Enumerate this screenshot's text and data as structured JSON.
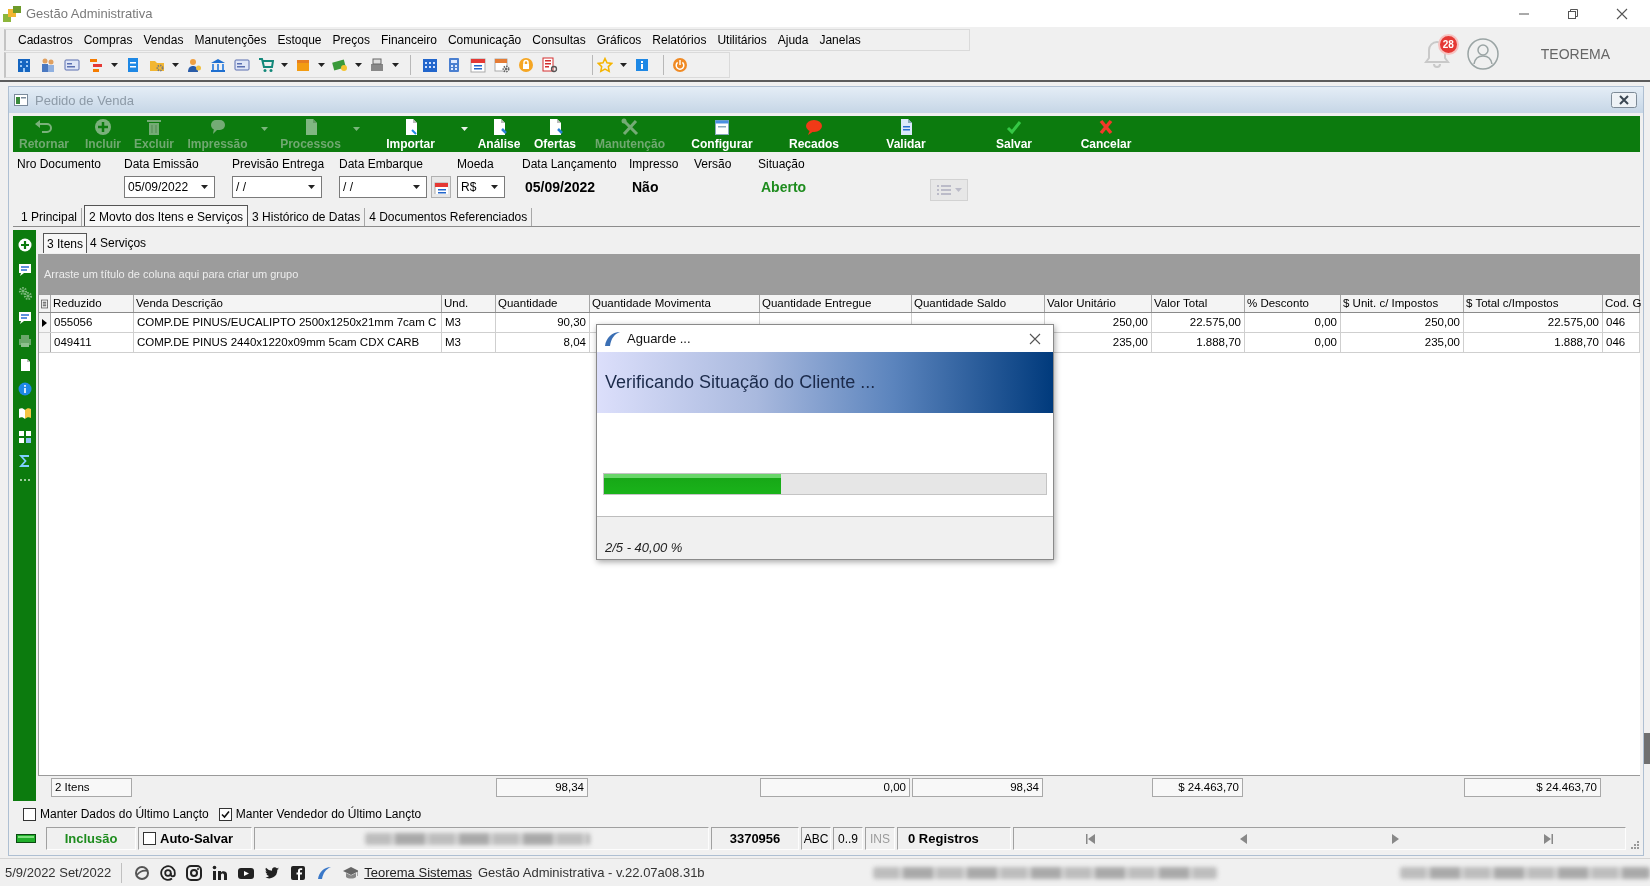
{
  "window": {
    "title": "Gestão Administrativa"
  },
  "menu": [
    "Cadastros",
    "Compras",
    "Vendas",
    "Manutenções",
    "Estoque",
    "Preços",
    "Financeiro",
    "Comunicação",
    "Consultas",
    "Gráficos",
    "Relatórios",
    "Utilitários",
    "Ajuda",
    "Janelas"
  ],
  "notifications": {
    "count": "28"
  },
  "user": {
    "name": "TEOREMA"
  },
  "document": {
    "title": "Pedido de Venda",
    "actions": [
      {
        "label": "Retornar",
        "disabled": true,
        "menu": false
      },
      {
        "label": "Incluir",
        "disabled": true,
        "menu": false
      },
      {
        "label": "Excluir",
        "disabled": true,
        "menu": false
      },
      {
        "label": "Impressão",
        "disabled": true,
        "menu": true
      },
      {
        "label": "Processos",
        "disabled": true,
        "menu": true
      },
      {
        "label": "Importar",
        "disabled": false,
        "menu": true
      },
      {
        "label": "Análise",
        "disabled": false,
        "menu": false
      },
      {
        "label": "Ofertas",
        "disabled": false,
        "menu": false
      },
      {
        "label": "Manutenção",
        "disabled": true,
        "menu": false
      },
      {
        "label": "Configurar",
        "disabled": false,
        "menu": false
      },
      {
        "label": "Recados",
        "disabled": false,
        "menu": false
      },
      {
        "label": "Validar",
        "disabled": false,
        "menu": false
      },
      {
        "label": "Salvar",
        "disabled": false,
        "menu": false
      },
      {
        "label": "Cancelar",
        "disabled": false,
        "menu": false
      }
    ],
    "fields": [
      {
        "kind": "label",
        "label": "Nro Documento"
      },
      {
        "kind": "combo",
        "label": "Data Emissão",
        "value": "05/09/2022"
      },
      {
        "kind": "combo",
        "label": "Previsão Entrega",
        "value": "/ /"
      },
      {
        "kind": "date",
        "label": "Data Embarque",
        "value": "/ /"
      },
      {
        "kind": "combo",
        "label": "Moeda",
        "value": "R$"
      },
      {
        "kind": "value",
        "label": "Data Lançamento",
        "value": "05/09/2022"
      },
      {
        "kind": "value",
        "label": "Impresso",
        "value": "Não"
      },
      {
        "kind": "label",
        "label": "Versão"
      },
      {
        "kind": "status",
        "label": "Situação",
        "value": "Aberto"
      }
    ],
    "view_button": {
      "disabled": true
    },
    "tabs": [
      {
        "label": "1 Principal",
        "selected": false
      },
      {
        "label": "2 Movto dos Itens e Serviços",
        "selected": true
      },
      {
        "label": "3 Histórico de Datas",
        "selected": false
      },
      {
        "label": "4 Documentos Referenciados",
        "selected": false
      }
    ],
    "subtabs": [
      {
        "label": "3 Itens",
        "selected": true
      },
      {
        "label": "4 Serviços",
        "selected": false
      }
    ],
    "group_hint": "Arraste um título de coluna aqui para criar um grupo",
    "table": {
      "columns": [
        {
          "label": "Reduzido",
          "kind": "text",
          "total": "2 Itens"
        },
        {
          "label": "Venda Descrição",
          "kind": "text"
        },
        {
          "label": "Und.",
          "kind": "text"
        },
        {
          "label": "Quantidade",
          "kind": "number",
          "total": "98,34"
        },
        {
          "label": "Quantidade Movimenta",
          "kind": "number"
        },
        {
          "label": "Quantidade Entregue",
          "kind": "number",
          "total": "0,00"
        },
        {
          "label": "Quantidade Saldo",
          "kind": "number",
          "total": "98,34"
        },
        {
          "label": "Valor Unitário",
          "kind": "number"
        },
        {
          "label": "Valor Total",
          "kind": "number",
          "total": "$ 24.463,70"
        },
        {
          "label": "% Desconto",
          "kind": "number"
        },
        {
          "label": "$ Unit. c/ Impostos",
          "kind": "number"
        },
        {
          "label": "$ Total c/Impostos",
          "kind": "number",
          "total": "$ 24.463,70"
        },
        {
          "label": "Cod. G",
          "kind": "text"
        }
      ],
      "rows": [
        {
          "selected": true,
          "cells": [
            "055056",
            "COMP.DE PINUS/EUCALIPTO 2500x1250x21mm 7cam C",
            "M3",
            "90,30",
            null,
            null,
            null,
            "250,00",
            "22.575,00",
            "0,00",
            "250,00",
            "22.575,00",
            "046"
          ]
        },
        {
          "selected": false,
          "cells": [
            "049411",
            "COMP.DE PINUS 2440x1220x09mm 5cam CDX CARB",
            "M3",
            "8,04",
            null,
            null,
            null,
            "235,00",
            "1.888,70",
            "0,00",
            "235,00",
            "1.888,70",
            "046"
          ]
        }
      ]
    },
    "options": [
      {
        "label": "Manter Dados do Último Lançto",
        "checked": false
      },
      {
        "label": "Manter Vendedor do Último Lançto",
        "checked": true
      }
    ],
    "status_bar": {
      "mode": "Inclusão",
      "autosave": {
        "label": "Auto-Salvar",
        "checked": false
      },
      "code": "3370956",
      "indicators": [
        {
          "label": "ABC",
          "disabled": false
        },
        {
          "label": "0..9",
          "disabled": false
        },
        {
          "label": "INS",
          "disabled": true
        }
      ],
      "records": "0 Registros"
    }
  },
  "dialog": {
    "title": "Aguarde ...",
    "message": "Verificando Situação do Cliente ...",
    "progress": {
      "level": 0.4
    },
    "step": "2/5 - 40,00 %"
  },
  "footer": {
    "date": "5/9/2022 Set/2022",
    "link": "Teorema Sistemas",
    "version": "Gestão Administrativa - v.22.07a08.31b"
  }
}
